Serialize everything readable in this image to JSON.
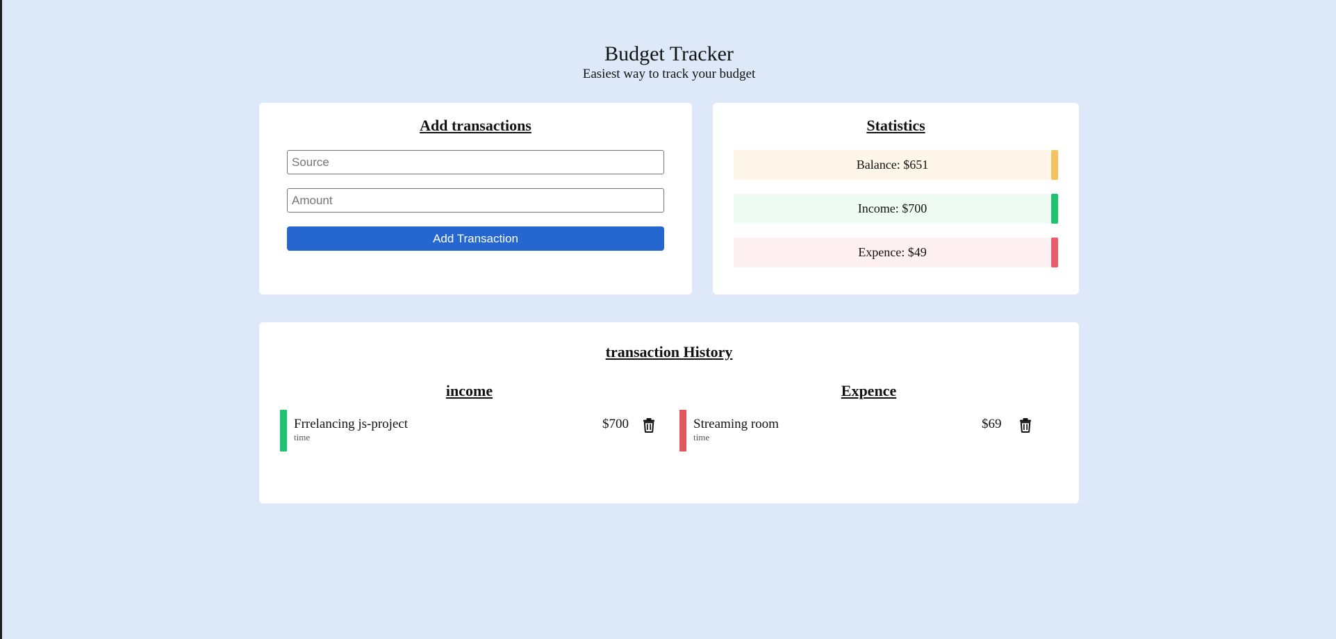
{
  "header": {
    "title": "Budget Tracker",
    "subtitle": "Easiest way to track your budget"
  },
  "add_card": {
    "title": "Add transactions",
    "source_placeholder": "Source",
    "source_value": "",
    "amount_placeholder": "Amount",
    "amount_value": "",
    "button_label": "Add Transaction"
  },
  "stats_card": {
    "title": "Statistics",
    "balance_label": "Balance: $651",
    "income_label": "Income: $700",
    "expense_label": "Expence: $49"
  },
  "history_card": {
    "title": "transaction History",
    "income": {
      "title": "income",
      "items": [
        {
          "source": "Frrelancing js-project",
          "time": "time",
          "amount": "$700"
        }
      ]
    },
    "expense": {
      "title": "Expence",
      "items": [
        {
          "source": "Streaming room",
          "time": "time",
          "amount": "$69"
        }
      ]
    }
  },
  "colors": {
    "background": "#dde9f9",
    "primary_button": "#2566d1",
    "balance_accent": "#f6c161",
    "income_accent": "#1ec46f",
    "expense_accent": "#ea5b6b"
  },
  "icons": {
    "delete": "trash-icon"
  }
}
